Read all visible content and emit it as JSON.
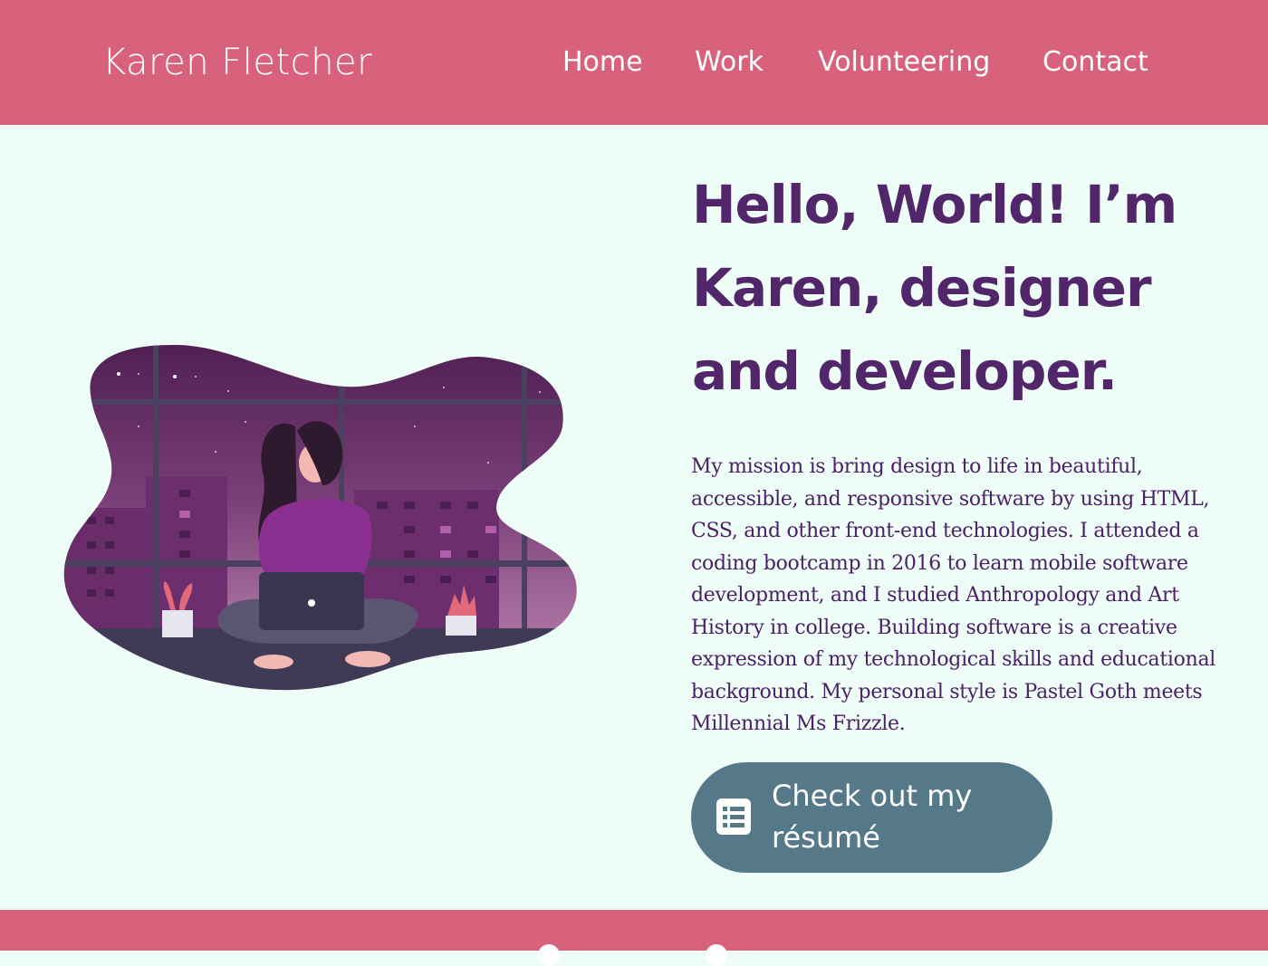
{
  "header": {
    "brand": "Karen Fletcher",
    "nav": [
      {
        "label": "Home"
      },
      {
        "label": "Work"
      },
      {
        "label": "Volunteering"
      },
      {
        "label": "Contact"
      }
    ]
  },
  "hero": {
    "headline": "Hello, World! I’m Karen, designer and developer.",
    "mission": "My mission is bring design to life in beautiful, accessible, and responsive software by using HTML, CSS, and other front-end technologies. I attended a coding bootcamp in 2016 to learn mobile software development, and I studied Anthropology and Art History in college. Building software is a creative expression of my technological skills and educational background. My personal style is Pastel Goth meets Millennial Ms Frizzle.",
    "resume_button": {
      "label": "Check out my résumé",
      "icon": "list-document-icon"
    },
    "illustration": {
      "icon": "woman-with-laptop-night-city-illustration"
    }
  },
  "footer": {
    "icons": [
      "social-icon",
      "social-icon"
    ]
  },
  "colors": {
    "header_bg": "#d8627c",
    "page_bg": "#effdf8",
    "headline": "#52266b",
    "body_text": "#4a2168",
    "button_bg": "#56798a",
    "footer_bg": "#d8627c"
  }
}
